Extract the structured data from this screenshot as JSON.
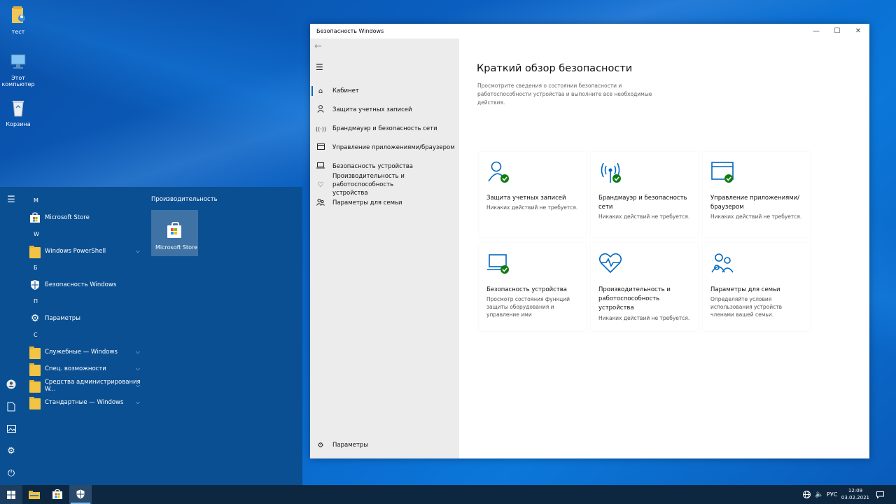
{
  "desktop": {
    "icons": [
      {
        "label": "тест"
      },
      {
        "label": "Этот компьютер"
      },
      {
        "label": "Корзина"
      }
    ]
  },
  "start_menu": {
    "groups": [
      {
        "letter": "M",
        "apps": [
          {
            "label": "Microsoft Store",
            "icon": "store-icon"
          }
        ]
      },
      {
        "letter": "W",
        "apps": [
          {
            "label": "Windows PowerShell",
            "icon": "folder-icon",
            "expandable": true
          }
        ]
      },
      {
        "letter": "Б",
        "apps": [
          {
            "label": "Безопасность Windows",
            "icon": "shield-icon"
          }
        ]
      },
      {
        "letter": "П",
        "apps": [
          {
            "label": "Параметры",
            "icon": "gear-icon"
          }
        ]
      },
      {
        "letter": "С",
        "apps": [
          {
            "label": "Служебные — Windows",
            "icon": "folder-icon",
            "expandable": true
          },
          {
            "label": "Спец. возможности",
            "icon": "folder-icon",
            "expandable": true
          },
          {
            "label": "Средства администрирования W...",
            "icon": "folder-icon",
            "expandable": true
          },
          {
            "label": "Стандартные — Windows",
            "icon": "folder-icon",
            "expandable": true
          }
        ]
      }
    ],
    "tiles_group_title": "Производительность",
    "tile": {
      "label": "Microsoft Store"
    }
  },
  "window": {
    "title": "Безопасность Windows",
    "nav": [
      {
        "label": "Кабинет",
        "icon": "home-icon",
        "active": true
      },
      {
        "label": "Защита учетных записей",
        "icon": "person-icon"
      },
      {
        "label": "Брандмауэр и безопасность сети",
        "icon": "antenna-icon"
      },
      {
        "label": "Управление приложениями/браузером",
        "icon": "browser-icon"
      },
      {
        "label": "Безопасность устройства",
        "icon": "laptop-icon"
      },
      {
        "label": "Производительность и работоспособность устройства",
        "icon": "heart-icon"
      },
      {
        "label": "Параметры для семьи",
        "icon": "family-icon"
      }
    ],
    "settings_label": "Параметры",
    "heading": "Краткий обзор безопасности",
    "description": "Просмотрите сведения о состоянии безопасности и работоспособности устройства и выполните все необходимые действия.",
    "cards": [
      {
        "title": "Защита учетных записей",
        "status": "Никаких действий не требуется.",
        "icon": "account-protection-icon"
      },
      {
        "title": "Брандмауэр и безопасность сети",
        "status": "Никаких действий не требуется.",
        "icon": "firewall-icon"
      },
      {
        "title": "Управление приложениями/браузером",
        "status": "Никаких действий не требуется.",
        "icon": "app-browser-icon"
      },
      {
        "title": "Безопасность устройства",
        "status": "Просмотр состояния функций защиты оборудования и управление ими",
        "icon": "device-security-icon"
      },
      {
        "title": "Производительность и работоспособность устройства",
        "status": "Никаких действий не требуется.",
        "icon": "device-health-icon"
      },
      {
        "title": "Параметры для семьи",
        "status": "Определяйте условия использования устройств членами вашей семьи.",
        "icon": "family-options-icon"
      }
    ],
    "accent": "#0067c0",
    "ok_color": "#107c10"
  },
  "taskbar": {
    "language": "РУС",
    "time": "12:09",
    "date": "03.02.2021"
  }
}
